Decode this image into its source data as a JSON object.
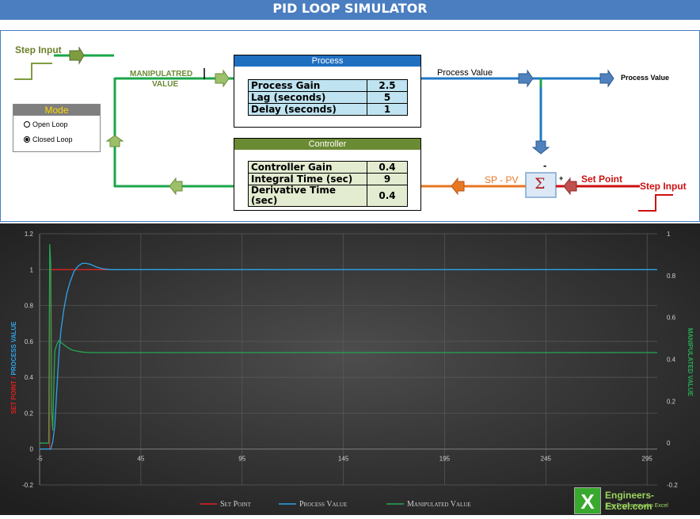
{
  "title": "PID LOOP SIMULATOR",
  "diagram": {
    "step_input_left": "Step Input",
    "step_input_right": "Step Input",
    "manipulated_label_line1": "MANIPULATRED",
    "manipulated_label_line2": "VALUE",
    "process_value_label": "Process Value",
    "process_value_out": "Process Value",
    "sp_pv_label": "SP - PV",
    "set_point_label": "Set Point",
    "sum_symbol": "Σ",
    "minus_sign": "-",
    "plus_sign": "+",
    "process": {
      "title": "Process",
      "rows": [
        {
          "label": "Process Gain",
          "value": "2.5"
        },
        {
          "label": "Lag (seconds)",
          "value": "5"
        },
        {
          "label": "Delay (seconds)",
          "value": "1"
        }
      ]
    },
    "controller": {
      "title": "Controller",
      "rows": [
        {
          "label": "Controller Gain",
          "value": "0.4"
        },
        {
          "label": "Integral Time (sec)",
          "value": "9"
        },
        {
          "label": "Derivative Time (sec)",
          "value": "0.4"
        }
      ]
    },
    "mode": {
      "title": "Mode",
      "options": [
        {
          "label": "Open Loop",
          "selected": false
        },
        {
          "label": "Closed Loop",
          "selected": true
        }
      ]
    },
    "colors": {
      "green": "#1aa64a",
      "blue": "#1f78c8",
      "orange": "#e87722",
      "red": "#cc1111",
      "process_header": "#1f6fc0",
      "controller_header": "#6b8a34",
      "process_cells": "#bfe3f0",
      "controller_cells": "#e3ecd0"
    }
  },
  "chart_data": {
    "type": "line",
    "x_ticks": [
      "-5",
      "45",
      "95",
      "145",
      "195",
      "245",
      "295"
    ],
    "y_left_ticks": [
      "-0.2",
      "0",
      "0.2",
      "0.4",
      "0.6",
      "0.8",
      "1",
      "1.2"
    ],
    "y_right_ticks": [
      "-0.2",
      "0",
      "0.2",
      "0.4",
      "0.6",
      "0.8",
      "1"
    ],
    "xlim": [
      -5,
      300
    ],
    "ylim_left": [
      -0.2,
      1.2
    ],
    "ylim_right": [
      -0.2,
      1
    ],
    "ylabel_left_part1": "SET POINT",
    "ylabel_left_sep": " / ",
    "ylabel_left_part2": "PROCESS VALUE",
    "ylabel_right": "MANIPULATED VALUE",
    "legend_position": "bottom",
    "series": [
      {
        "name": "Set Point",
        "axis": "left",
        "color": "#e02020",
        "x": [
          -5,
          0,
          0,
          30
        ],
        "y": [
          0,
          0,
          1,
          1
        ]
      },
      {
        "name": "Process Value",
        "axis": "left",
        "color": "#2ea3e8",
        "x": [
          -5,
          0.5,
          1.5,
          2.5,
          3.5,
          4.5,
          5.5,
          7,
          8.5,
          10,
          12,
          14,
          16,
          18,
          20,
          23,
          26,
          30,
          35,
          45,
          300
        ],
        "y": [
          0,
          0,
          0.04,
          0.13,
          0.33,
          0.52,
          0.66,
          0.78,
          0.87,
          0.93,
          0.99,
          1.02,
          1.035,
          1.035,
          1.03,
          1.015,
          1.005,
          1.0,
          1.0,
          1.0,
          1.0
        ]
      },
      {
        "name": "Manipulated Value",
        "axis": "right",
        "color": "#27a653",
        "x": [
          -5,
          -0.5,
          0,
          0.5,
          1,
          1.5,
          2,
          2.5,
          3.5,
          4.5,
          5.5,
          7,
          9,
          11,
          13,
          16,
          20,
          25,
          30,
          40,
          300
        ],
        "y": [
          0,
          0,
          0.95,
          0.85,
          0.15,
          0.06,
          0.27,
          0.44,
          0.47,
          0.49,
          0.48,
          0.47,
          0.455,
          0.445,
          0.44,
          0.435,
          0.432,
          0.432,
          0.432,
          0.432,
          0.432
        ]
      }
    ]
  },
  "logo": {
    "mark": "X",
    "name": "Engineers-Excel.com",
    "tagline": "For Engineers who Excel"
  }
}
